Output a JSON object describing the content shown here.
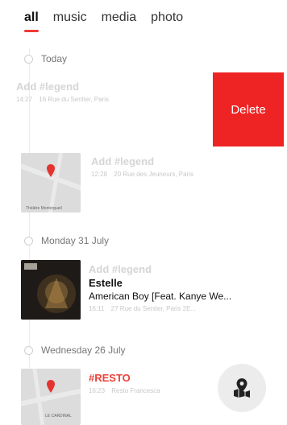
{
  "tabs": [
    {
      "label": "all",
      "active": true
    },
    {
      "label": "music",
      "active": false
    },
    {
      "label": "media",
      "active": false
    },
    {
      "label": "photo",
      "active": false
    }
  ],
  "accent_color": "#ef3b35",
  "sections": {
    "today": {
      "label": "Today",
      "entries": [
        {
          "legend": "Add #legend",
          "time": "14:27",
          "place": "16 Rue du Sentier, Paris",
          "delete_label": "Delete"
        },
        {
          "legend": "Add #legend",
          "time": "12:28",
          "place": "20 Rue des Jeuneurs, Paris",
          "thumb_caption": "Théâtre Montorgueil"
        }
      ]
    },
    "monday": {
      "label": "Monday 31 July",
      "entries": [
        {
          "legend": "Add #legend",
          "artist": "Estelle",
          "title": "American Boy [Feat. Kanye We...",
          "time": "16:11",
          "place": "27 Rue du Sentier, Paris 2E..."
        }
      ]
    },
    "wednesday": {
      "label": "Wednesday 26 July",
      "entries": [
        {
          "tag": "#RESTO",
          "time": "16:23",
          "place": "Resto Francesca",
          "thumb_caption": "LE CARDINAL"
        }
      ]
    }
  },
  "fab": {
    "icon": "map-pin-icon"
  }
}
